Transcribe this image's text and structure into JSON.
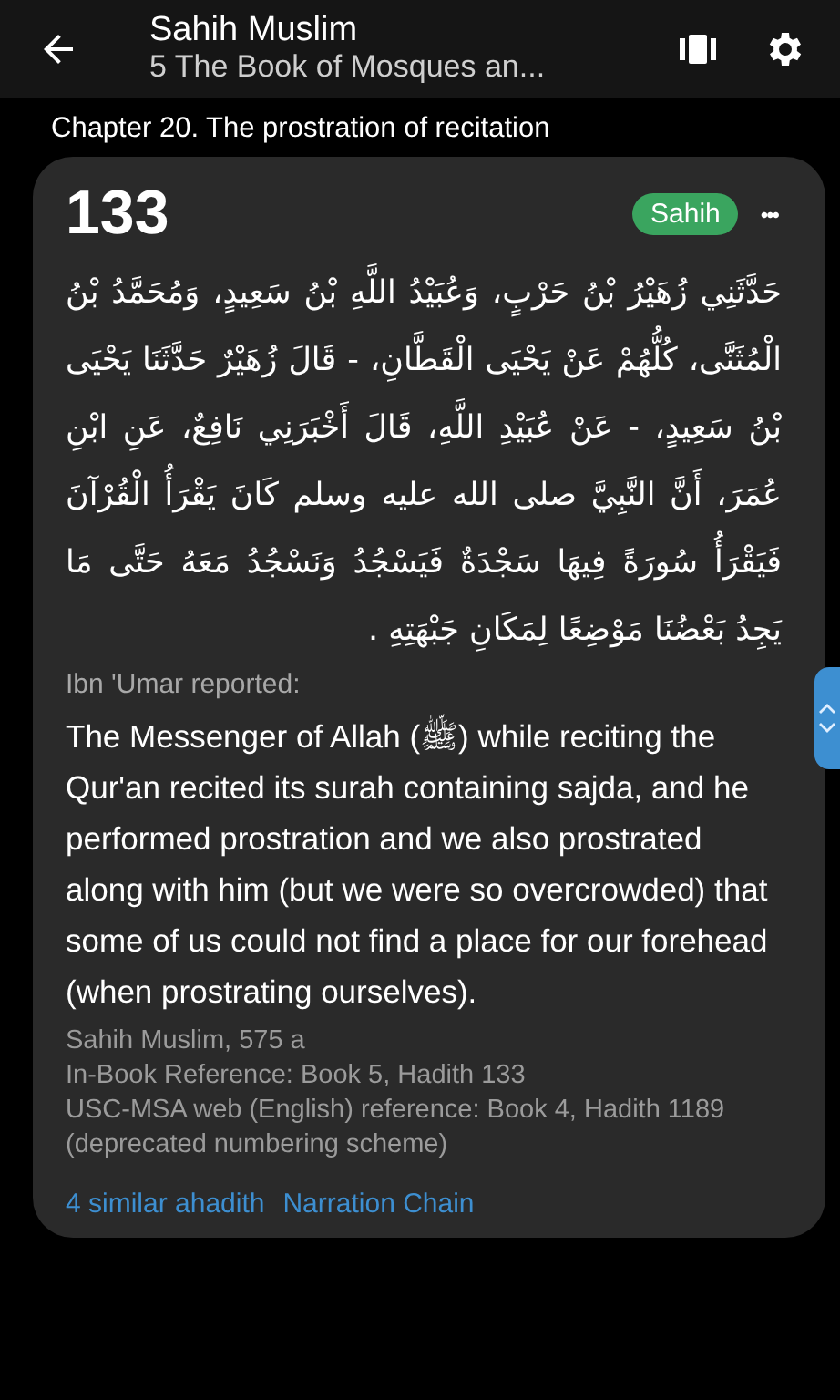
{
  "header": {
    "title": "Sahih Muslim",
    "subtitle": "5 The Book of Mosques an..."
  },
  "chapter": "Chapter 20. The prostration of recitation",
  "hadith": {
    "number": "133",
    "grade": "Sahih",
    "more": "•••",
    "arabic": "حَدَّثَنِي زُهَيْرُ بْنُ حَرْبٍ، وَعُبَيْدُ اللَّهِ بْنُ سَعِيدٍ، وَمُحَمَّدُ بْنُ الْمُثَنَّى، كُلُّهُمْ عَنْ يَحْيَى الْقَطَّانِ، - قَالَ زُهَيْرٌ حَدَّثَنَا يَحْيَى بْنُ سَعِيدٍ، - عَنْ عُبَيْدِ اللَّهِ، قَالَ أَخْبَرَنِي نَافِعٌ، عَنِ ابْنِ عُمَرَ، أَنَّ النَّبِيَّ صلى الله عليه وسلم كَانَ يَقْرَأُ الْقُرْآنَ فَيَقْرَأُ سُورَةً فِيهَا سَجْدَةٌ فَيَسْجُدُ وَنَسْجُدُ مَعَهُ حَتَّى مَا يَجِدُ بَعْضُنَا مَوْضِعًا لِمَكَانِ جَبْهَتِهِ .",
    "narrator": "Ibn 'Umar reported:",
    "english": "The Messenger of Allah (ﷺ) while reciting the Qur'an recited its surah containing sajda, and he performed prostration and we also prostrated along with him (but we were so overcrowded) that some of us could not find a place for our forehead (when prostrating ourselves).",
    "references": [
      "Sahih Muslim, 575 a",
      "In-Book Reference: Book 5, Hadith 133",
      "USC-MSA web (English) reference: Book 4, Hadith 1189 (deprecated numbering scheme)"
    ],
    "similar_link": "4 similar ahadith",
    "chain_link": "Narration Chain"
  }
}
